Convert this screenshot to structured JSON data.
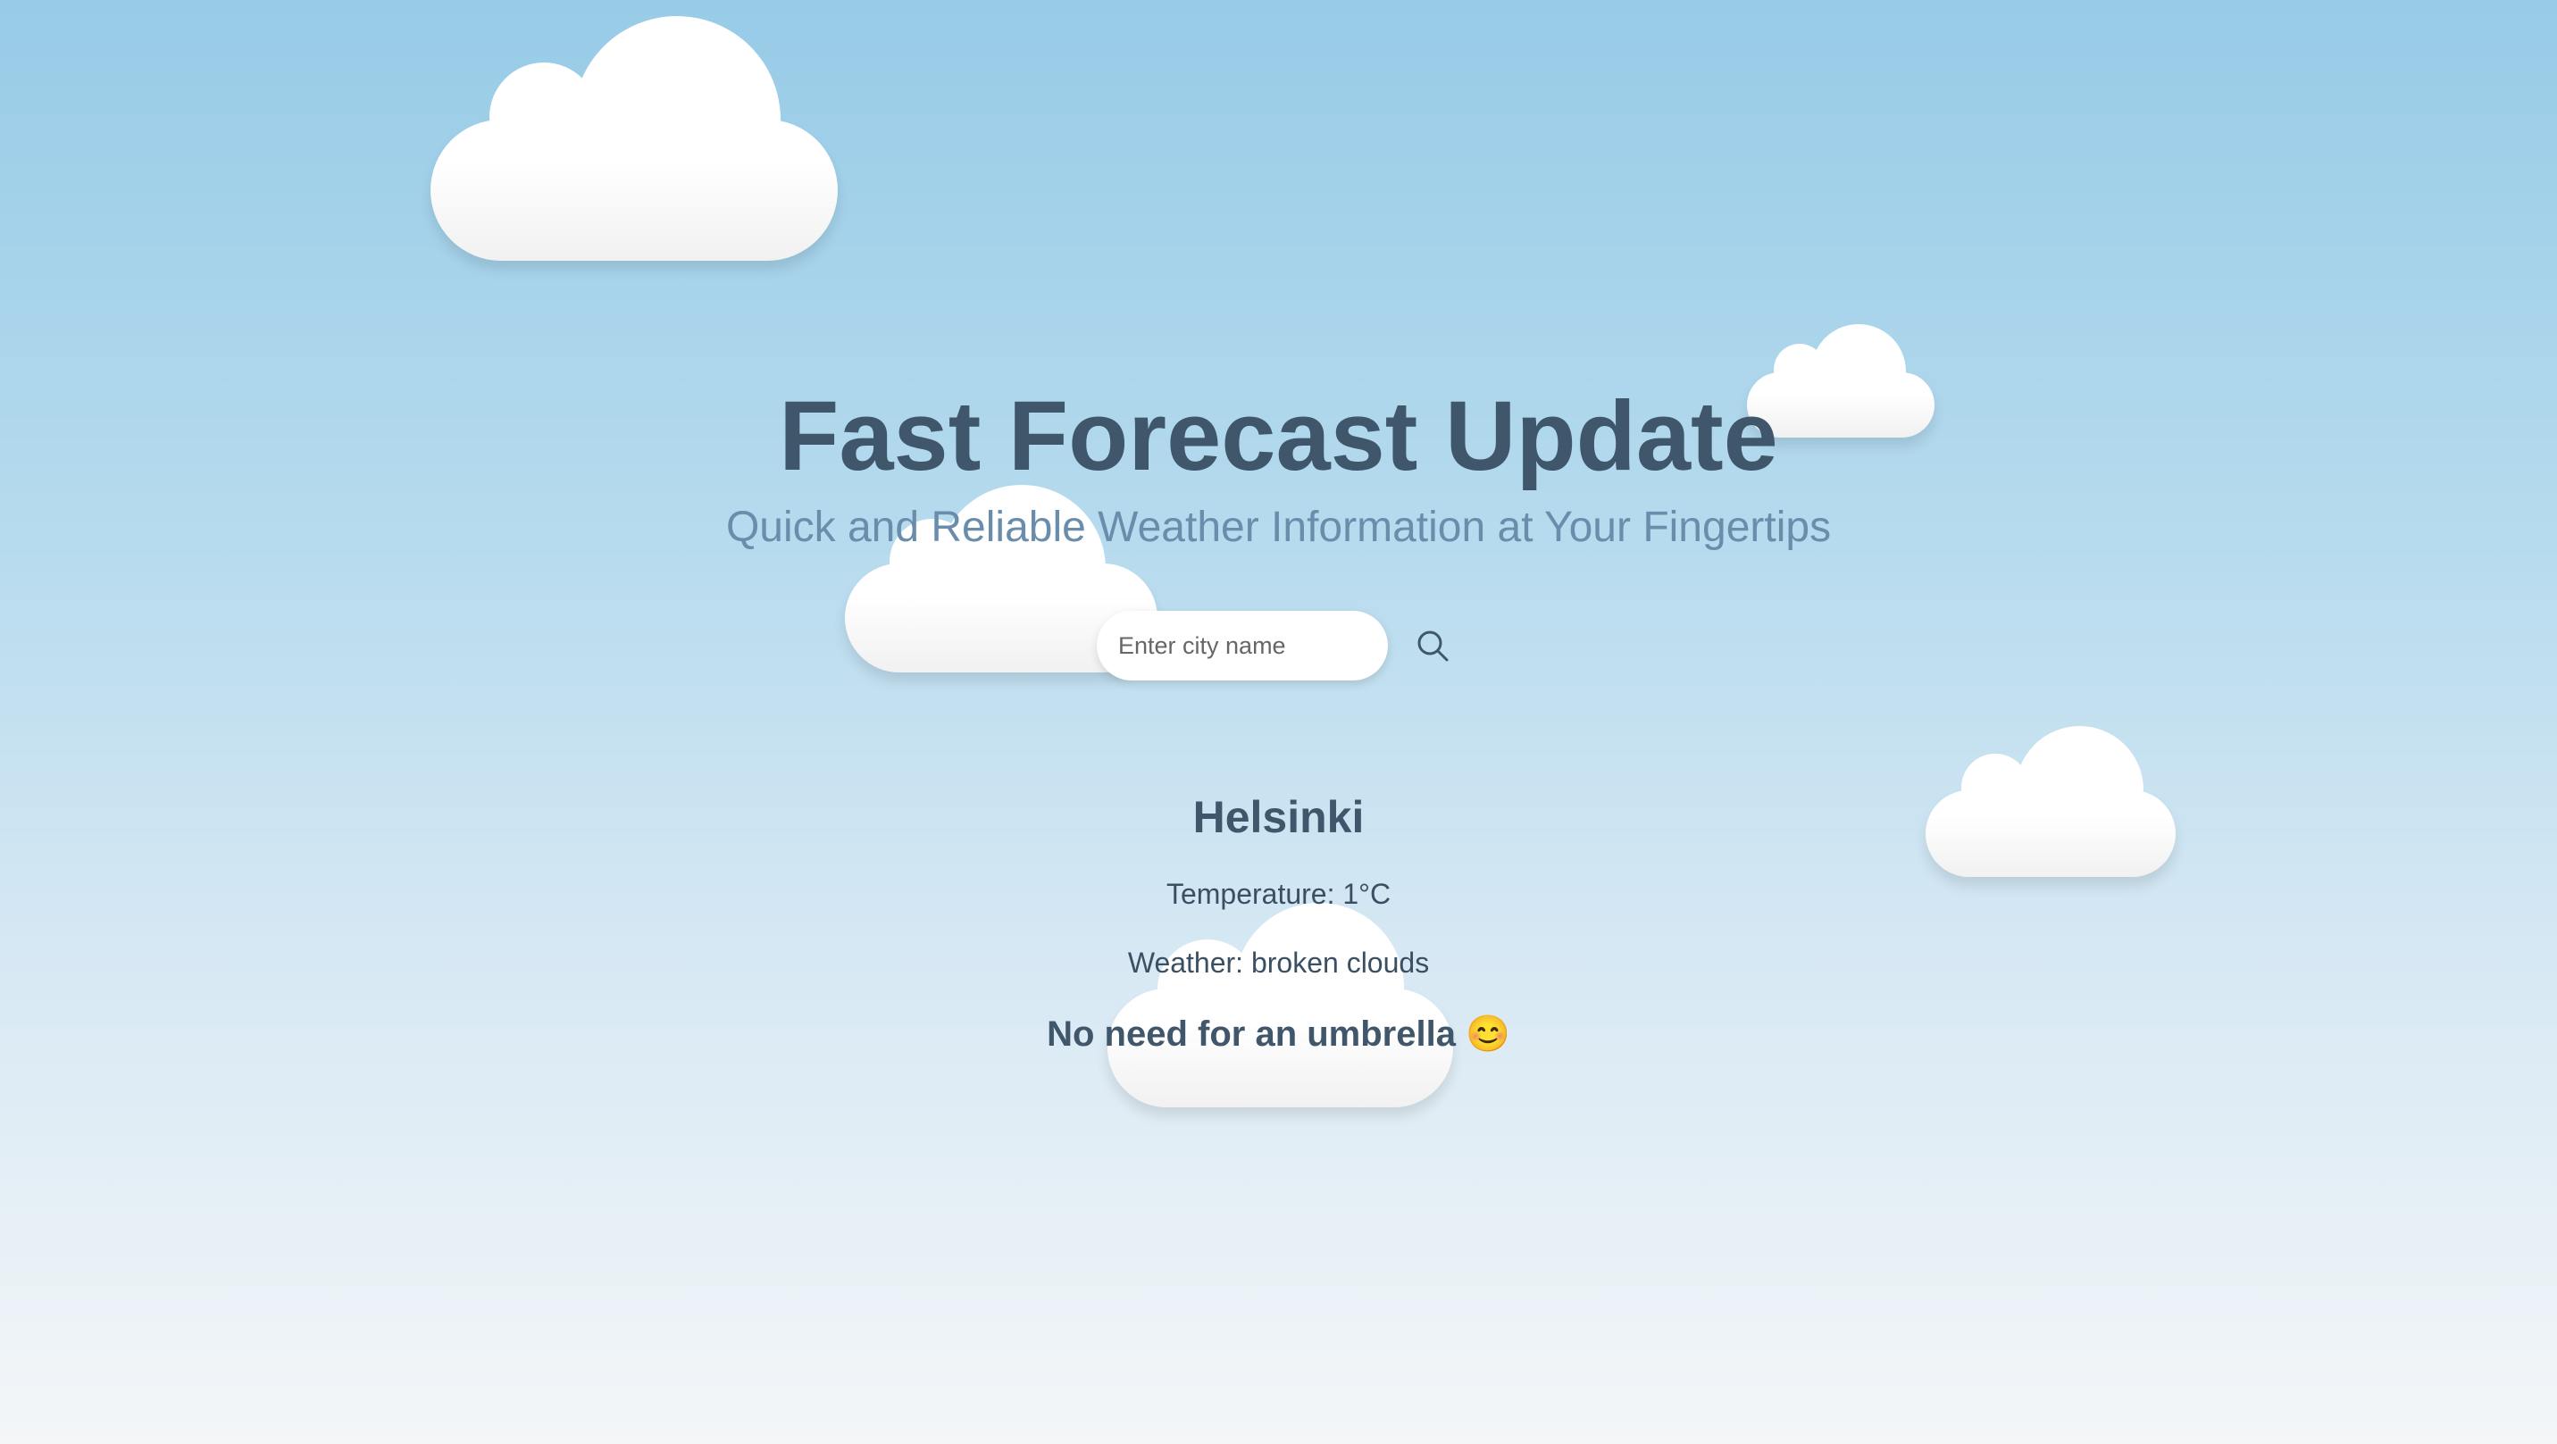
{
  "header": {
    "title": "Fast Forecast Update",
    "subtitle": "Quick and Reliable Weather Information at Your Fingertips"
  },
  "search": {
    "value": "",
    "placeholder": "Enter city name",
    "button_icon": "search-icon"
  },
  "weather": {
    "city": "Helsinki",
    "temperature": "Temperature: 1°C",
    "description": "Weather: broken clouds",
    "umbrella_message": "No need for an umbrella 😊"
  },
  "colors": {
    "title": "#3f566b",
    "subtitle": "#6a8dab",
    "sky_top": "#97cbe7",
    "sky_bottom": "#f4f6f8"
  },
  "decorations": {
    "cloud_icon": "cloud-icon"
  }
}
